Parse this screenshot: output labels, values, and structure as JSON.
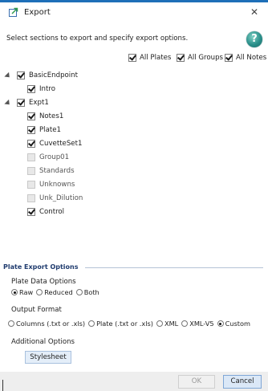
{
  "window": {
    "title": "Export",
    "close_glyph": "✕"
  },
  "instructions": "Select sections to export and specify export options.",
  "help": {
    "glyph": "?"
  },
  "top_options": [
    {
      "label": "All Plates",
      "checked": true
    },
    {
      "label": "All Groups",
      "checked": true
    },
    {
      "label": "All Notes",
      "checked": true
    }
  ],
  "tree": {
    "basic_endpoint": {
      "label": "BasicEndpoint",
      "checked": true,
      "children": [
        {
          "label": "Intro",
          "checked": true
        }
      ]
    },
    "expt1": {
      "label": "Expt1",
      "checked": true,
      "children": [
        {
          "label": "Notes1",
          "checked": true,
          "enabled": true
        },
        {
          "label": "Plate1",
          "checked": true,
          "enabled": true
        },
        {
          "label": "CuvetteSet1",
          "checked": true,
          "enabled": true
        },
        {
          "label": "Group01",
          "checked": false,
          "enabled": false
        },
        {
          "label": "Standards",
          "checked": false,
          "enabled": false
        },
        {
          "label": "Unknowns",
          "checked": false,
          "enabled": false
        },
        {
          "label": "Unk_Dilution",
          "checked": false,
          "enabled": false
        },
        {
          "label": "Control",
          "checked": true,
          "enabled": true
        }
      ]
    }
  },
  "plate_export": {
    "section_title": "Plate Export Options",
    "data_options_label": "Plate Data Options",
    "data_options": [
      {
        "label": "Raw",
        "selected": true
      },
      {
        "label": "Reduced",
        "selected": false
      },
      {
        "label": "Both",
        "selected": false
      }
    ],
    "output_format_label": "Output Format",
    "output_formats": [
      {
        "label": "Columns (.txt or .xls)",
        "selected": false
      },
      {
        "label": "Plate (.txt or .xls)",
        "selected": false
      },
      {
        "label": "XML",
        "selected": false
      },
      {
        "label": "XML-V5",
        "selected": false
      },
      {
        "label": "Custom",
        "selected": true
      }
    ],
    "additional_label": "Additional Options",
    "stylesheet_label": "Stylesheet"
  },
  "footer": {
    "ok_label": "OK",
    "cancel_label": "Cancel",
    "ok_enabled": false
  },
  "colors": {
    "accent": "#1e6fb8",
    "section_title": "#1f3b6e",
    "button_blue": "#dbe8f7"
  }
}
